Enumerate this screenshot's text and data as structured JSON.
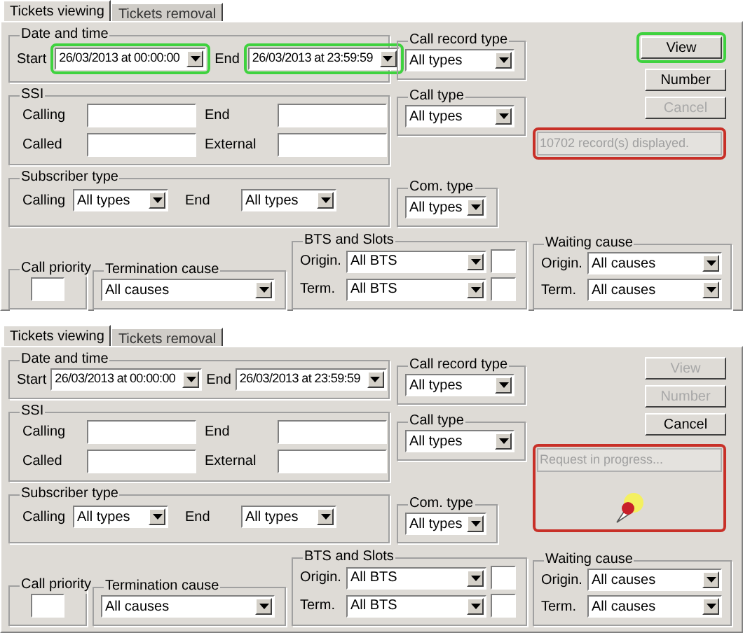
{
  "panels": [
    {
      "tabs": [
        {
          "label": "Tickets viewing",
          "selected": true
        },
        {
          "label": "Tickets removal",
          "selected": false
        }
      ],
      "date_time": {
        "title": "Date and time",
        "start_label": "Start",
        "start_value": "26/03/2013 at 00:00:00",
        "start_highlighted": true,
        "end_label": "End",
        "end_value": "26/03/2013 at 23:59:59",
        "end_highlighted": true
      },
      "ssi": {
        "title": "SSI",
        "fields": [
          {
            "label": "Calling"
          },
          {
            "label": "End"
          },
          {
            "label": "Called"
          },
          {
            "label": "External"
          }
        ]
      },
      "subscriber_type": {
        "title": "Subscriber type",
        "fields": [
          {
            "label": "Calling",
            "value": "All types"
          },
          {
            "label": "End",
            "value": "All types"
          }
        ]
      },
      "call_record_type": {
        "title": "Call record type",
        "value": "All types"
      },
      "call_type": {
        "title": "Call type",
        "value": "All types"
      },
      "com_type": {
        "title": "Com. type",
        "value": "All types"
      },
      "buttons": [
        {
          "label": "View",
          "disabled": false,
          "highlighted": true
        },
        {
          "label": "Number",
          "disabled": false,
          "highlighted": false
        },
        {
          "label": "Cancel",
          "disabled": true,
          "highlighted": false
        }
      ],
      "status": {
        "text": "10702 record(s) displayed.",
        "highlighted": true,
        "busy": false
      },
      "call_priority": {
        "title": "Call priority"
      },
      "termination_cause": {
        "title": "Termination cause",
        "value": "All causes"
      },
      "bts_slots": {
        "title": "BTS and Slots",
        "rows": [
          {
            "label": "Origin.",
            "value": "All BTS"
          },
          {
            "label": "Term.",
            "value": "All BTS"
          }
        ]
      },
      "waiting_cause": {
        "title": "Waiting cause",
        "rows": [
          {
            "label": "Origin.",
            "value": "All causes"
          },
          {
            "label": "Term.",
            "value": "All causes"
          }
        ]
      }
    },
    {
      "tabs": [
        {
          "label": "Tickets viewing",
          "selected": true
        },
        {
          "label": "Tickets removal",
          "selected": false
        }
      ],
      "date_time": {
        "title": "Date and time",
        "start_label": "Start",
        "start_value": "26/03/2013 at 00:00:00",
        "start_highlighted": false,
        "end_label": "End",
        "end_value": "26/03/2013 at 23:59:59",
        "end_highlighted": false
      },
      "ssi": {
        "title": "SSI",
        "fields": [
          {
            "label": "Calling"
          },
          {
            "label": "End"
          },
          {
            "label": "Called"
          },
          {
            "label": "External"
          }
        ]
      },
      "subscriber_type": {
        "title": "Subscriber type",
        "fields": [
          {
            "label": "Calling",
            "value": "All types"
          },
          {
            "label": "End",
            "value": "All types"
          }
        ]
      },
      "call_record_type": {
        "title": "Call record type",
        "value": "All types"
      },
      "call_type": {
        "title": "Call type",
        "value": "All types"
      },
      "com_type": {
        "title": "Com. type",
        "value": "All types"
      },
      "buttons": [
        {
          "label": "View",
          "disabled": true,
          "highlighted": false
        },
        {
          "label": "Number",
          "disabled": true,
          "highlighted": false
        },
        {
          "label": "Cancel",
          "disabled": false,
          "highlighted": false
        }
      ],
      "status": {
        "text": "Request in progress...",
        "highlighted": true,
        "busy": true
      },
      "call_priority": {
        "title": "Call priority"
      },
      "termination_cause": {
        "title": "Termination cause",
        "value": "All causes"
      },
      "bts_slots": {
        "title": "BTS and Slots",
        "rows": [
          {
            "label": "Origin.",
            "value": "All BTS"
          },
          {
            "label": "Term.",
            "value": "All BTS"
          }
        ]
      },
      "waiting_cause": {
        "title": "Waiting cause",
        "rows": [
          {
            "label": "Origin.",
            "value": "All causes"
          },
          {
            "label": "Term.",
            "value": "All causes"
          }
        ]
      }
    }
  ]
}
